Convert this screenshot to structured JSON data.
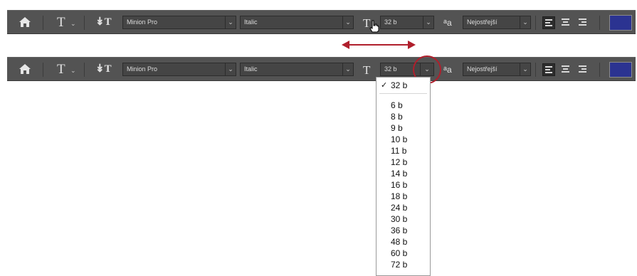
{
  "colors": {
    "toolbar_bg": "#535353",
    "annotation": "#b01f2c",
    "text_color_swatch": "#2b3391"
  },
  "icons": [
    "home-icon",
    "type-tool-icon",
    "text-orientation-icon",
    "font-size-icon",
    "anti-alias-icon",
    "align-left-icon",
    "align-center-icon",
    "align-right-icon",
    "mouse-hand-cursor-icon",
    "double-arrow-icon"
  ],
  "toolbar": {
    "type_tool_glyph": "T",
    "orientation_glyph": "↡T",
    "font_size_glyph": "T",
    "font_family": "Minion Pro",
    "font_style": "Italic",
    "font_size": "32 b",
    "aa_glyph": "a",
    "aa_glyph_small": "a",
    "anti_alias": "Nejostřejší"
  },
  "size_menu": {
    "selected": "32 b",
    "options": [
      "6 b",
      "8 b",
      "9 b",
      "10 b",
      "11 b",
      "12 b",
      "14 b",
      "16 b",
      "18 b",
      "24 b",
      "30 b",
      "36 b",
      "48 b",
      "60 b",
      "72 b"
    ]
  }
}
